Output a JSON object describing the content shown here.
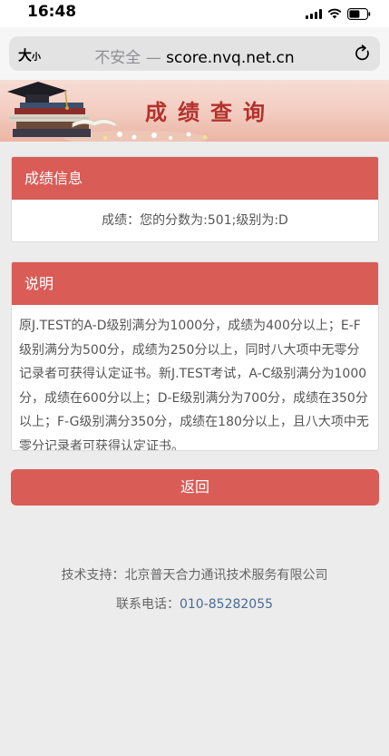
{
  "status_bar": {
    "time": "16:48"
  },
  "browser": {
    "text_size_label": "大",
    "text_size_small": "小",
    "insecure_label": "不安全 —",
    "domain": "score.nvq.net.cn"
  },
  "banner": {
    "title": "成绩查询"
  },
  "result_panel": {
    "title": "成绩信息",
    "text": "成绩：您的分数为:501;级别为:D"
  },
  "info_panel": {
    "title": "说明",
    "text": "原J.TEST的A-D级别满分为1000分，成绩为400分以上；E-F级别满分为500分，成绩为250分以上，同时八大项中无零分记录者可获得认定证书。新J.TEST考试，A-C级别满分为1000分，成绩在600分以上；D-E级别满分为700分，成绩在350分以上；F-G级别满分350分，成绩在180分以上，且八大项中无零分记录者可获得认定证书。"
  },
  "back_button": {
    "label": "返回"
  },
  "footer": {
    "support_label": "技术支持：",
    "support_company": "北京普天合力通讯技术服务有限公司",
    "phone_label": "联系电话：",
    "phone": "010-85282055"
  },
  "colors": {
    "accent": "#d95c57",
    "page_bg": "#ececec",
    "phone_link": "#4a6a95"
  }
}
